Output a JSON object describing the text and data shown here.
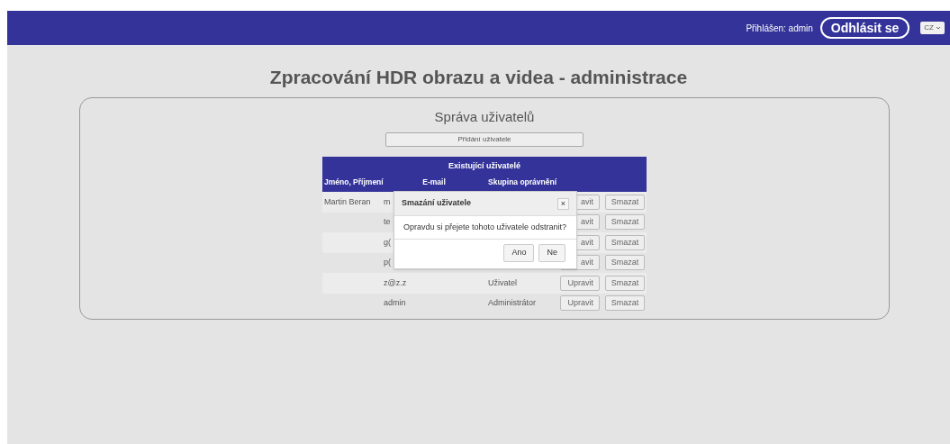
{
  "header": {
    "login_label": "Přihlášen: admin",
    "logout_button": "Odhlásit se",
    "language": "CZ"
  },
  "page_title": "Zpracování HDR obrazu a videa - administrace",
  "panel": {
    "title": "Správa uživatelů",
    "add_button": "Přidání uživatele",
    "table": {
      "caption": "Existující uživatelé",
      "columns": [
        "Jméno, Příjmení",
        "E-mail",
        "Skupina oprávnění"
      ],
      "rows": [
        {
          "name": "Martin Beran",
          "email": "m",
          "group": "",
          "edit": "avit",
          "delete": "Smazat"
        },
        {
          "name": "",
          "email": "te",
          "group": "",
          "edit": "avit",
          "delete": "Smazat"
        },
        {
          "name": "",
          "email": "g(",
          "group": "",
          "edit": "avit",
          "delete": "Smazat"
        },
        {
          "name": "",
          "email": "p(",
          "group": "",
          "edit": "avit",
          "delete": "Smazat"
        },
        {
          "name": "",
          "email": "z@z.z",
          "group": "Uživatel",
          "edit": "Upravit",
          "delete": "Smazat"
        },
        {
          "name": "",
          "email": "admin",
          "group": "Administrátor",
          "edit": "Upravit",
          "delete": "Smazat"
        }
      ]
    }
  },
  "dialog": {
    "title": "Smazání uživatele",
    "close": "×",
    "message": "Opravdu si přejete tohoto uživatele odstranit?",
    "buttons": [
      "Ano",
      "Ne"
    ]
  }
}
